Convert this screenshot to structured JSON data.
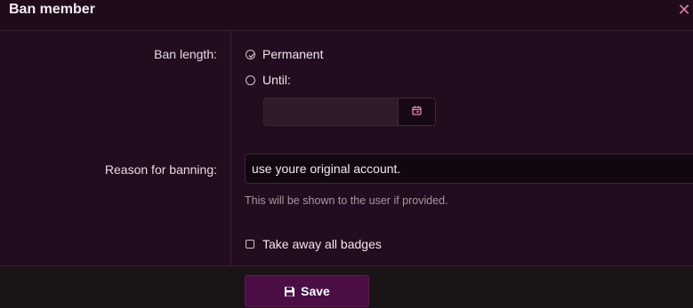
{
  "dialog": {
    "title": "Ban member",
    "close_icon": "close-icon"
  },
  "ban_length": {
    "label": "Ban length:",
    "options": [
      {
        "label": "Permanent",
        "checked": true
      },
      {
        "label": "Until:",
        "checked": false
      }
    ],
    "date_value": "",
    "calendar_icon": "calendar-icon"
  },
  "reason": {
    "label": "Reason for banning:",
    "value": "use youre original account.",
    "hint": "This will be shown to the user if provided."
  },
  "badges": {
    "label": "Take away all badges",
    "checked": false
  },
  "footer": {
    "save_label": "Save",
    "save_icon": "save-icon"
  },
  "colors": {
    "accent": "#4a0e45",
    "close": "#d17aa8",
    "calendar": "#e58ab5"
  }
}
